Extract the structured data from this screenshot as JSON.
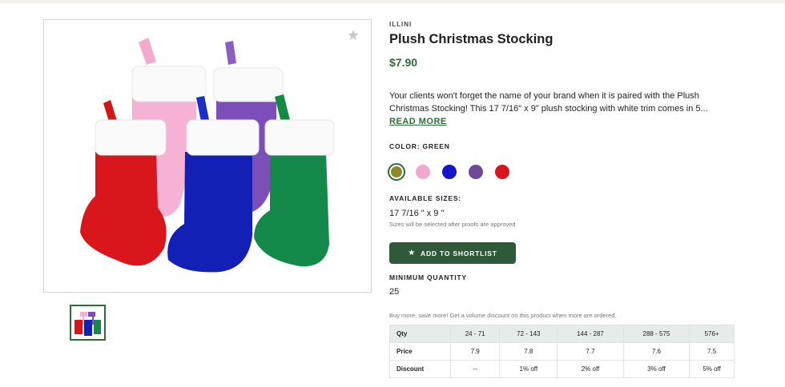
{
  "product": {
    "brand": "ILLINI",
    "title": "Plush Christmas Stocking",
    "price": "$7.90",
    "description": "Your clients won't forget the name of your brand when it is paired with the Plush Christmas Stocking! This 17 7/16\" x 9\" plush stocking with white trim comes in 5...",
    "read_more": "READ MORE"
  },
  "color": {
    "label": "COLOR: GREEN",
    "swatches": [
      {
        "name": "green",
        "hex": "#8a8a2a",
        "selected": true
      },
      {
        "name": "pink",
        "hex": "#f2a9cf"
      },
      {
        "name": "blue",
        "hex": "#1414c8"
      },
      {
        "name": "purple",
        "hex": "#6e4a98"
      },
      {
        "name": "red",
        "hex": "#d8141e"
      }
    ]
  },
  "sizes": {
    "label": "AVAILABLE SIZES:",
    "value": "17 7/16 \" x 9 \"",
    "note": "Sizes will be selected after proofs are approved"
  },
  "shortlist_button": "ADD TO SHORTLIST",
  "minimum_quantity": {
    "label": "MINIMUM QUANTITY",
    "value": "25"
  },
  "discount_note": "Buy more, save more! Get a volume discount on this product when more are ordered.",
  "pricing_table": {
    "headers": [
      "Qty",
      "24 - 71",
      "72 - 143",
      "144 - 287",
      "288 - 575",
      "576+"
    ],
    "price_row": [
      "Price",
      "7.9",
      "7.8",
      "7.7",
      "7.6",
      "7.5"
    ],
    "discount_row": [
      "Discount",
      "--",
      "1% off",
      "2% off",
      "3% off",
      "5% off"
    ]
  },
  "icons": {
    "favorite": "star-icon",
    "shortlist": "star-icon"
  },
  "colors": {
    "brand_green": "#2f6b3a",
    "button_green": "#2f5a3a"
  }
}
